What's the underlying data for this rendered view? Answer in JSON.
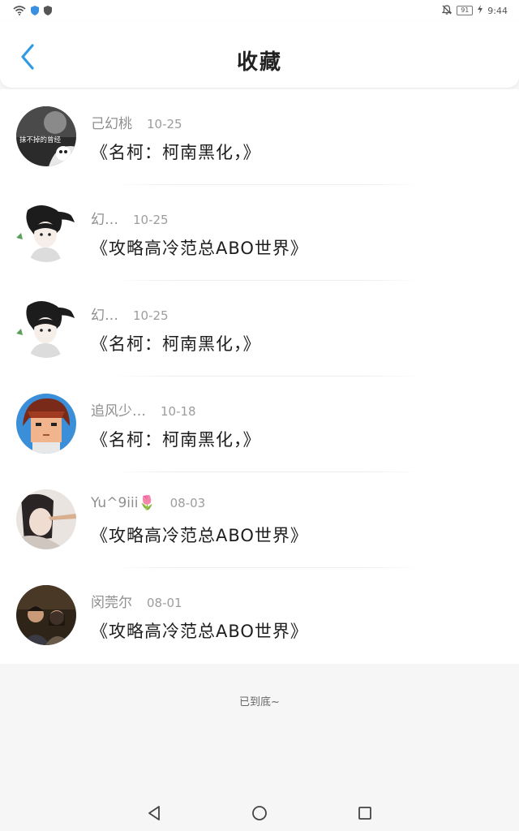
{
  "status_bar": {
    "time": "9:44",
    "battery": "91",
    "icons": [
      "wifi-icon",
      "shield-icon",
      "security-icon",
      "mute-bell-icon",
      "battery-icon",
      "charging-icon"
    ]
  },
  "header": {
    "title": "收藏",
    "back_icon": "back-chevron-icon",
    "accent_color": "#2f9be6"
  },
  "items": [
    {
      "author": "己幻桃",
      "date": "10-25",
      "title": "《名柯：柯南黑化，》",
      "avatar_text": "抹不掉的曾经"
    },
    {
      "author": "幻…",
      "date": "10-25",
      "title": "《攻略高冷范总ABO世界》"
    },
    {
      "author": "幻…",
      "date": "10-25",
      "title": "《名柯：柯南黑化，》"
    },
    {
      "author": "追风少…",
      "date": "10-18",
      "title": "《名柯：柯南黑化，》"
    },
    {
      "author": "Yu^9iii🌷",
      "date": "08-03",
      "title": "《攻略高冷范总ABO世界》"
    },
    {
      "author": "闵莞尔",
      "date": "08-01",
      "title": "《攻略高冷范总ABO世界》"
    }
  ],
  "footer": {
    "end_text": "已到底~"
  },
  "nav": {
    "icons": [
      "back-triangle-icon",
      "home-circle-icon",
      "recents-square-icon"
    ]
  }
}
